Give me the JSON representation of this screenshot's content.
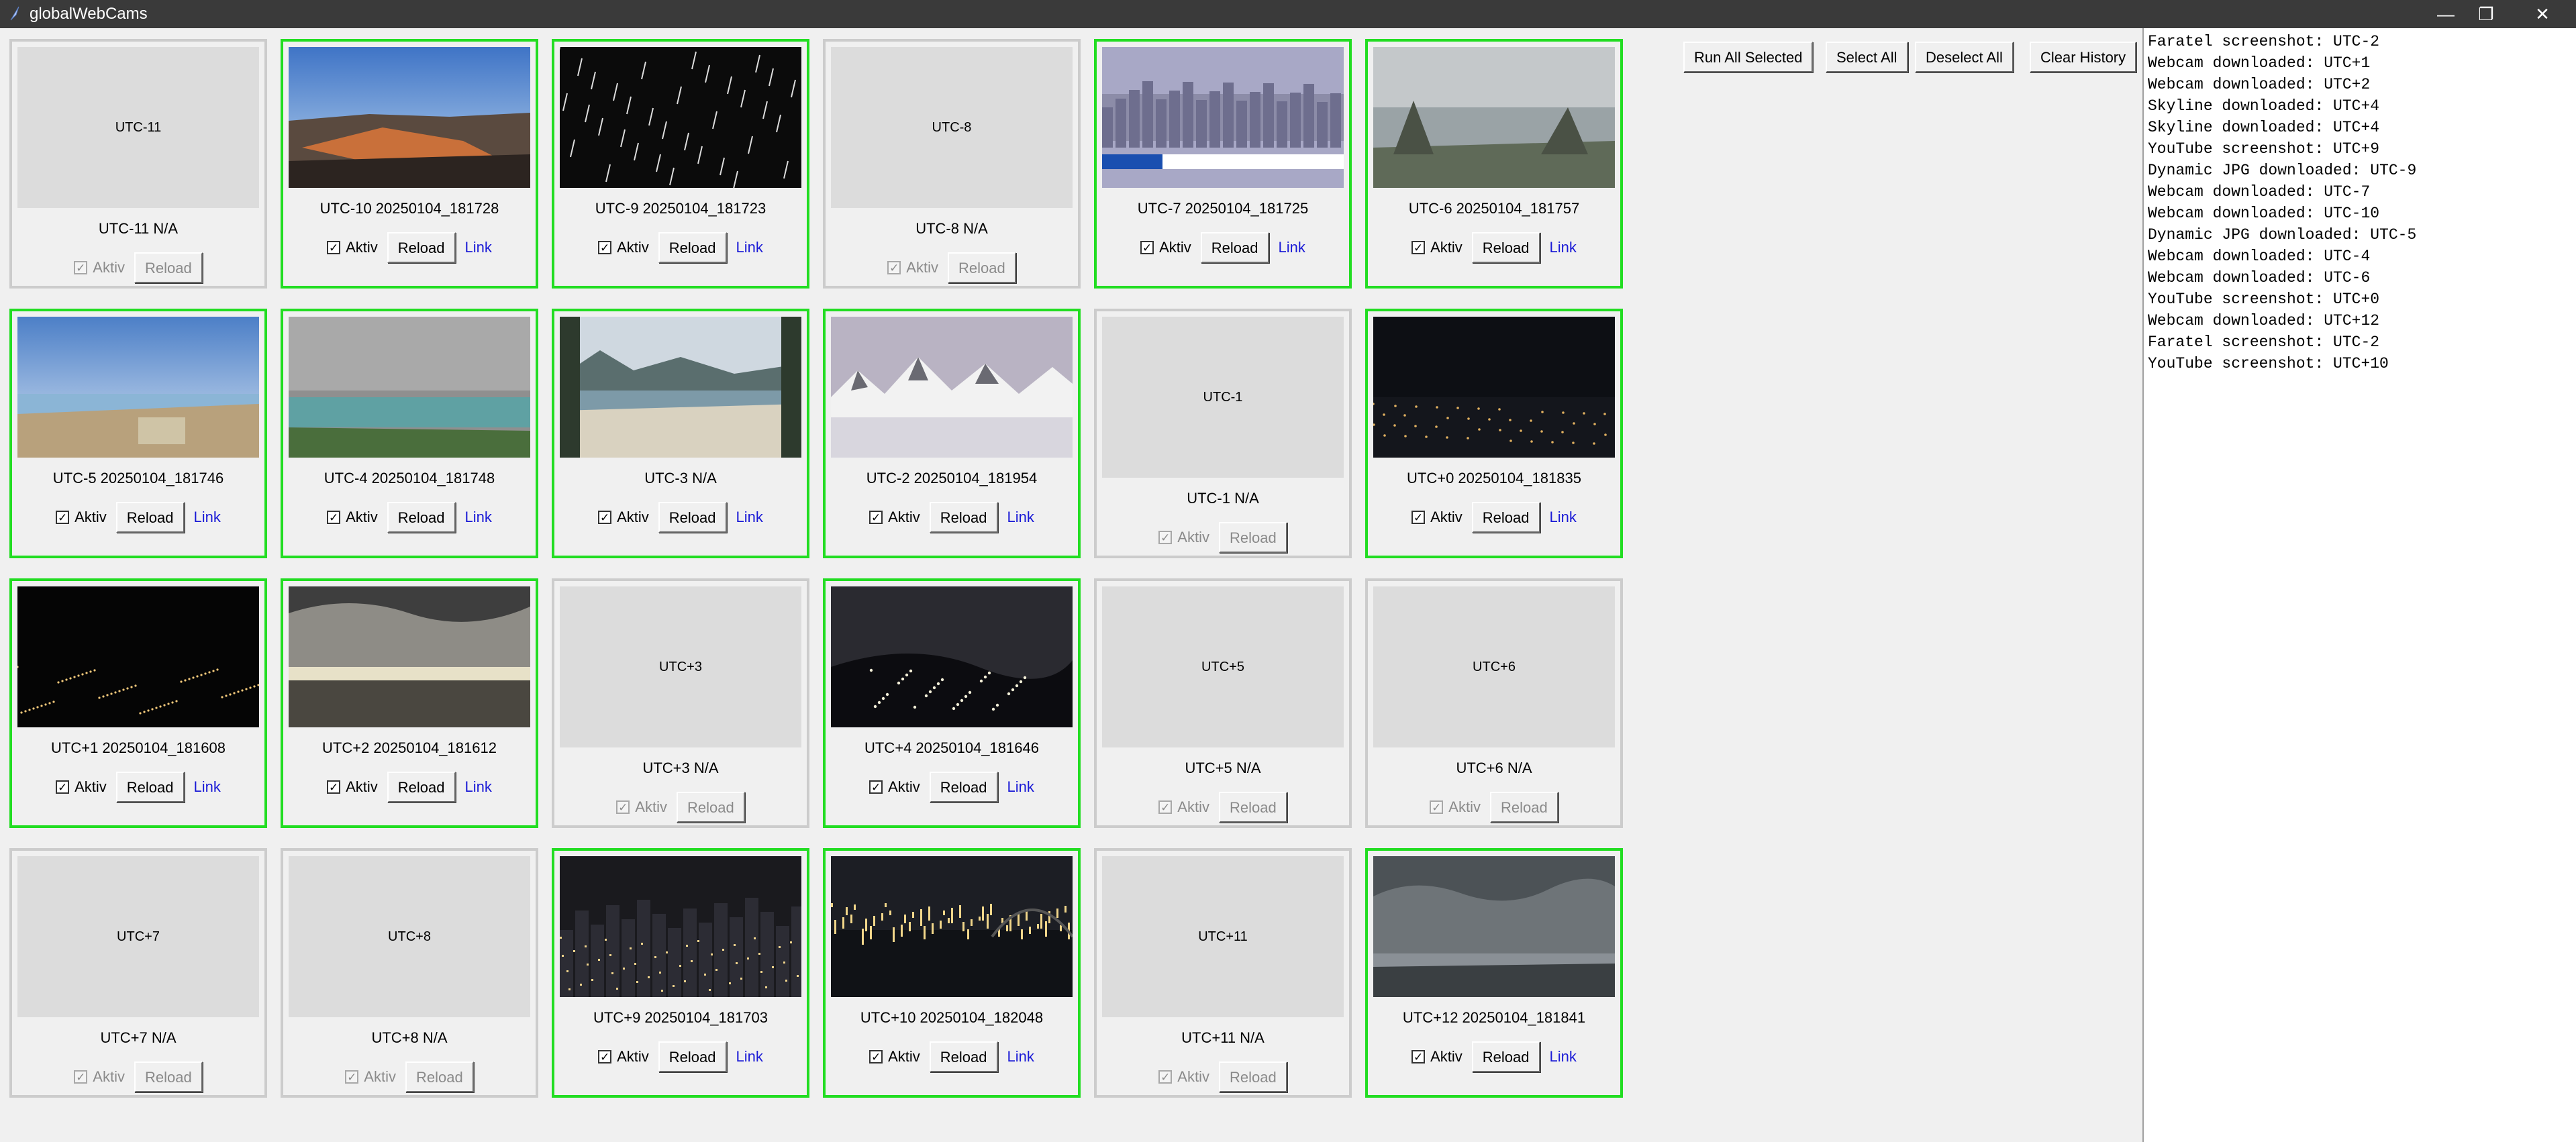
{
  "window": {
    "title": "globalWebCams",
    "controls": {
      "minimize": "—",
      "restore": "❐",
      "close": "✕"
    }
  },
  "labels": {
    "aktiv": "Aktiv",
    "reload": "Reload",
    "link": "Link",
    "check": "✓"
  },
  "toolbar": {
    "run_all_selected": "Run All Selected",
    "select_all": "Select All",
    "deselect_all": "Deselect All",
    "clear_history": "Clear History"
  },
  "cams": [
    {
      "tz": "UTC-11",
      "active": false,
      "caption": "UTC-11 N/A",
      "placeholder": "UTC-11",
      "scene": null
    },
    {
      "tz": "UTC-10",
      "active": true,
      "caption": "UTC-10 20250104_181728",
      "placeholder": "",
      "scene": "volcano"
    },
    {
      "tz": "UTC-9",
      "active": true,
      "caption": "UTC-9 20250104_181723",
      "placeholder": "",
      "scene": "snow-night"
    },
    {
      "tz": "UTC-8",
      "active": false,
      "caption": "UTC-8 N/A",
      "placeholder": "UTC-8",
      "scene": null
    },
    {
      "tz": "UTC-7",
      "active": true,
      "caption": "UTC-7 20250104_181725",
      "placeholder": "",
      "scene": "city-haze"
    },
    {
      "tz": "UTC-6",
      "active": true,
      "caption": "UTC-6 20250104_181757",
      "placeholder": "",
      "scene": "overcast-field"
    },
    {
      "tz": "UTC-5",
      "active": true,
      "caption": "UTC-5 20250104_181746",
      "placeholder": "",
      "scene": "coast-sunny"
    },
    {
      "tz": "UTC-4",
      "active": true,
      "caption": "UTC-4 20250104_181748",
      "placeholder": "",
      "scene": "sea-cloudy"
    },
    {
      "tz": "UTC-3",
      "active": true,
      "caption": "UTC-3 N/A",
      "placeholder": "",
      "scene": "beach-town"
    },
    {
      "tz": "UTC-2",
      "active": true,
      "caption": "UTC-2 20250104_181954",
      "placeholder": "",
      "scene": "snow-mountains"
    },
    {
      "tz": "UTC-1",
      "active": false,
      "caption": "UTC-1 N/A",
      "placeholder": "UTC-1",
      "scene": null
    },
    {
      "tz": "UTC+0",
      "active": true,
      "caption": "UTC+0 20250104_181835",
      "placeholder": "",
      "scene": "night-skyline"
    },
    {
      "tz": "UTC+1",
      "active": true,
      "caption": "UTC+1 20250104_181608",
      "placeholder": "",
      "scene": "night-lights"
    },
    {
      "tz": "UTC+2",
      "active": true,
      "caption": "UTC+2 20250104_181612",
      "placeholder": "",
      "scene": "sunset-clouds"
    },
    {
      "tz": "UTC+3",
      "active": false,
      "caption": "UTC+3 N/A",
      "placeholder": "UTC+3",
      "scene": null
    },
    {
      "tz": "UTC+4",
      "active": true,
      "caption": "UTC+4 20250104_181646",
      "placeholder": "",
      "scene": "night-hill"
    },
    {
      "tz": "UTC+5",
      "active": false,
      "caption": "UTC+5 N/A",
      "placeholder": "UTC+5",
      "scene": null
    },
    {
      "tz": "UTC+6",
      "active": false,
      "caption": "UTC+6 N/A",
      "placeholder": "UTC+6",
      "scene": null
    },
    {
      "tz": "UTC+7",
      "active": false,
      "caption": "UTC+7 N/A",
      "placeholder": "UTC+7",
      "scene": null
    },
    {
      "tz": "UTC+8",
      "active": false,
      "caption": "UTC+8 N/A",
      "placeholder": "UTC+8",
      "scene": null
    },
    {
      "tz": "UTC+9",
      "active": true,
      "caption": "UTC+9 20250104_181703",
      "placeholder": "",
      "scene": "night-city"
    },
    {
      "tz": "UTC+10",
      "active": true,
      "caption": "UTC+10 20250104_182048",
      "placeholder": "",
      "scene": "harbour-night"
    },
    {
      "tz": "UTC+11",
      "active": false,
      "caption": "UTC+11 N/A",
      "placeholder": "UTC+11",
      "scene": null
    },
    {
      "tz": "UTC+12",
      "active": true,
      "caption": "UTC+12 20250104_181841",
      "placeholder": "",
      "scene": "cloudy-harbour"
    }
  ],
  "log": [
    "Faratel screenshot: UTC-2",
    "Webcam downloaded: UTC+1",
    "Webcam downloaded: UTC+2",
    "Skyline downloaded: UTC+4",
    "Skyline downloaded: UTC+4",
    "YouTube screenshot: UTC+9",
    "Dynamic JPG downloaded: UTC-9",
    "Webcam downloaded: UTC-7",
    "Webcam downloaded: UTC-10",
    "Dynamic JPG downloaded: UTC-5",
    "Webcam downloaded: UTC-4",
    "Webcam downloaded: UTC-6",
    "YouTube screenshot: UTC+0",
    "Webcam downloaded: UTC+12",
    "Faratel screenshot: UTC-2",
    "YouTube screenshot: UTC+10"
  ]
}
